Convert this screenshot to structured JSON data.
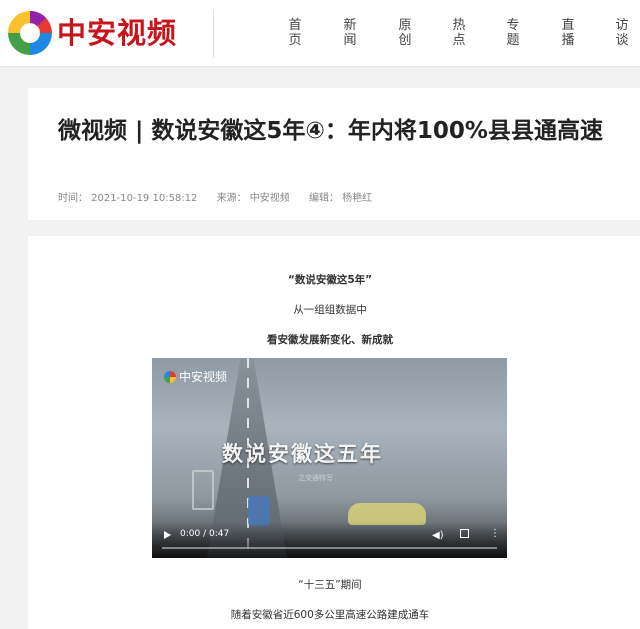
{
  "header": {
    "logo_text": "中安视频",
    "nav": [
      {
        "label": "首页"
      },
      {
        "label": "新闻"
      },
      {
        "label": "原创"
      },
      {
        "label": "热点"
      },
      {
        "label": "专题"
      },
      {
        "label": "直播"
      },
      {
        "label": "访谈"
      }
    ]
  },
  "article": {
    "title": "微视频 | 数说安徽这5年④：年内将100%县县通高速",
    "meta": {
      "time": "时间： 2021-10-19 10:58:12",
      "source": "来源： 中安视频",
      "editor": "编辑： 杨艳红"
    },
    "paragraphs": {
      "p1": "“数说安徽这5年”",
      "p2": "从一组组数据中",
      "p3": "看安徽发展新变化、新成就",
      "p4": "“十三五”期间",
      "p5": "随着安徽省近600多公里高速公路建成通车"
    },
    "video": {
      "logo_text": "中安视频",
      "title_text": "数说安徽这五年",
      "subtitle_text": "之交通特写",
      "time": "0:00 / 0:47",
      "progress": 0
    }
  },
  "colors": {
    "brand_red": "#c8151b",
    "background": "#f2f2f2"
  }
}
